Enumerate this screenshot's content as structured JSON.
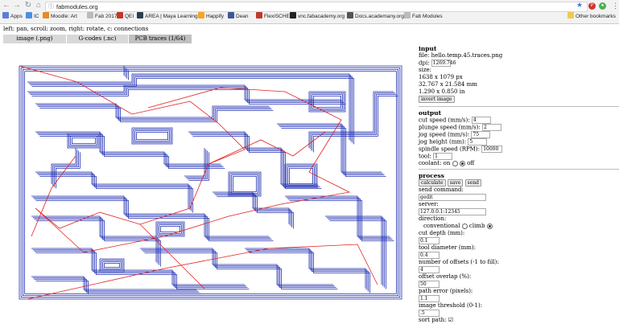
{
  "browser": {
    "url": "fabmodules.org",
    "bookmarks": [
      {
        "label": "Apps",
        "color": "#5a7fd6"
      },
      {
        "label": "IC",
        "color": "#4a90e2"
      },
      {
        "label": "Moodle: Art",
        "color": "#e58a2b"
      },
      {
        "label": "Fab 2017",
        "color": "#bbbbbb"
      },
      {
        "label": "QEI",
        "color": "#c0392b"
      },
      {
        "label": "AREA | Maya Learning",
        "color": "#2c3e50"
      },
      {
        "label": "Happify",
        "color": "#f5a623"
      },
      {
        "label": "Dean",
        "color": "#3b5998"
      },
      {
        "label": "FlexiSCHED",
        "color": "#c0392b"
      },
      {
        "label": "vnc.fabacademy.org",
        "color": "#222222"
      },
      {
        "label": "Docs.academany.org",
        "color": "#555555"
      },
      {
        "label": "Fab Modules",
        "color": "#bbbbbb"
      },
      {
        "label": "Other bookmarks",
        "color": "#f2c94c"
      }
    ]
  },
  "app": {
    "hint": "left: pan, scroll: zoom, right: rotate, c: connections",
    "tabs": [
      "image (.png)",
      "G-codes (.nc)",
      "PCB traces (1/64)"
    ]
  },
  "input": {
    "heading": "input",
    "file": "file: hello.temp.45.traces.png",
    "dpi_label": "dpi:",
    "dpi_value": "1269.746",
    "size_label": "size:",
    "size_px": "1638 x 1079 px",
    "size_mm": "32.767 x 21.584 mm",
    "size_in": "1.290 x 0.850 in",
    "invert_button": "invert image"
  },
  "output": {
    "heading": "output",
    "cut_speed_label": "cut speed (mm/s):",
    "cut_speed": "4",
    "plunge_label": "plunge speed (mm/s):",
    "plunge": "2",
    "jog_speed_label": "jog speed (mm/s):",
    "jog_speed": "75",
    "jog_height_label": "jog height (mm):",
    "jog_height": "5",
    "spindle_label": "spindle speed (RPM):",
    "spindle": "10000",
    "tool_label": "tool:",
    "tool": "1",
    "coolant_label": "coolant: on",
    "coolant_off": "off"
  },
  "process": {
    "heading": "process",
    "calculate": "calculate",
    "save": "save",
    "send": "send",
    "send_command_label": "send command:",
    "send_command": "gedit",
    "server_label": "server:",
    "server": "127.0.0.1:12345",
    "direction_label": "direction:",
    "conventional": "conventional",
    "climb": "climb",
    "cut_depth_label": "cut depth (mm):",
    "cut_depth": "0.1",
    "tool_diameter_label": "tool diameter (mm):",
    "tool_diameter": "0.4",
    "offsets_label": "number of offsets (-1 to fill):",
    "offsets": "4",
    "overlap_label": "offset overlap (%):",
    "overlap": "50",
    "path_error_label": "path error (pixels):",
    "path_error": "1.1",
    "threshold_label": "image threshold (0-1):",
    "threshold": ".5",
    "sort_label": "sort path:"
  },
  "colors": {
    "trace": "#1c2bb0",
    "jog": "#e22020",
    "panel_border": "#bbbbbb"
  }
}
